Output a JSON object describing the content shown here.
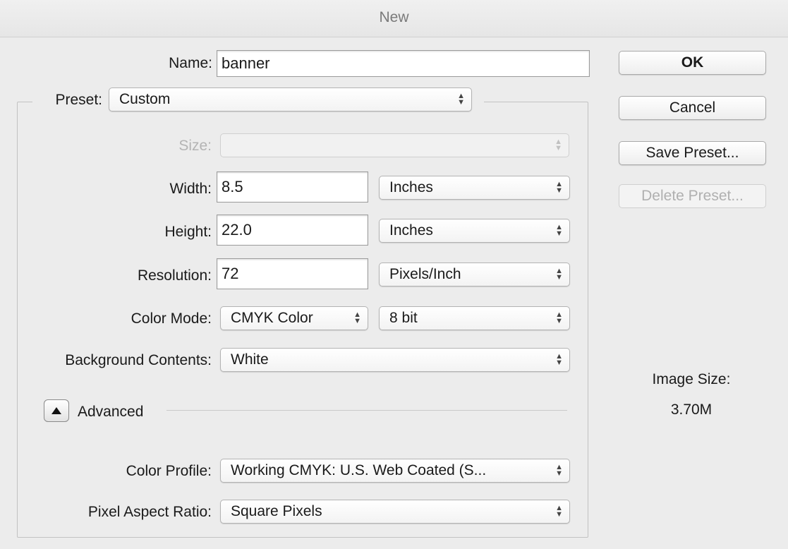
{
  "window": {
    "title": "New"
  },
  "name": {
    "label": "Name:",
    "value": "banner"
  },
  "preset": {
    "label": "Preset:",
    "value": "Custom"
  },
  "size": {
    "label": "Size:",
    "value": ""
  },
  "width": {
    "label": "Width:",
    "value": "8.5",
    "unit": "Inches"
  },
  "height": {
    "label": "Height:",
    "value": "22.0",
    "unit": "Inches"
  },
  "resolution": {
    "label": "Resolution:",
    "value": "72",
    "unit": "Pixels/Inch"
  },
  "color_mode": {
    "label": "Color Mode:",
    "mode": "CMYK Color",
    "depth": "8 bit"
  },
  "background": {
    "label": "Background Contents:",
    "value": "White"
  },
  "advanced": {
    "label": "Advanced",
    "expanded": true
  },
  "color_profile": {
    "label": "Color Profile:",
    "value": "Working CMYK:  U.S. Web Coated (S..."
  },
  "pixel_aspect": {
    "label": "Pixel Aspect Ratio:",
    "value": "Square Pixels"
  },
  "buttons": {
    "ok": "OK",
    "cancel": "Cancel",
    "save_preset": "Save Preset...",
    "delete_preset": "Delete Preset..."
  },
  "image_size": {
    "label": "Image Size:",
    "value": "3.70M"
  },
  "icons": {
    "popup": "up-down-arrows-icon",
    "disclosure": "triangle-up-icon"
  }
}
